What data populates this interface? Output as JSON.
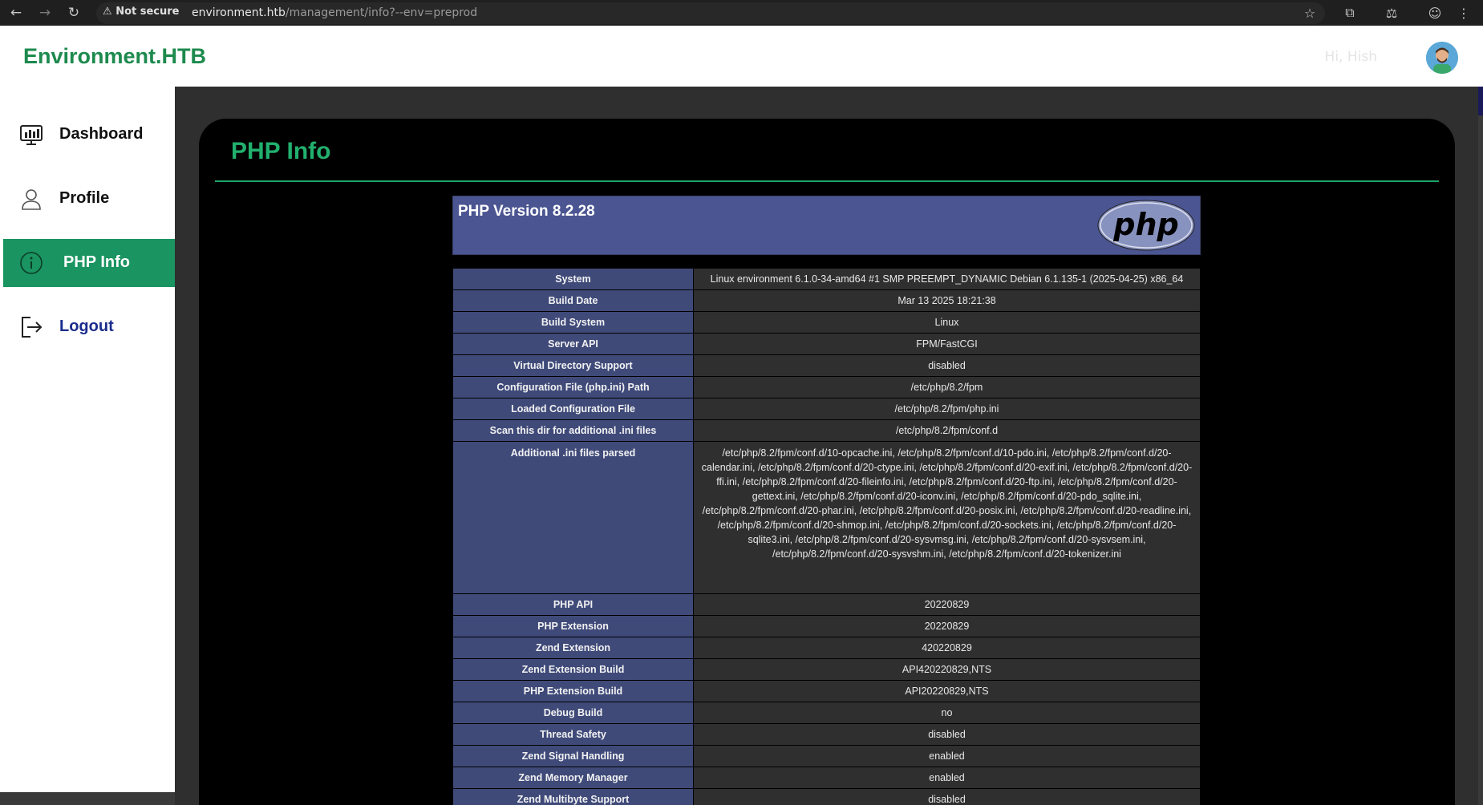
{
  "browser": {
    "warning": "Not secure",
    "url_host": "environment.htb",
    "url_path": "/management/info?--env=preprod"
  },
  "header": {
    "brand": "Environment.HTB",
    "greeting": "Hi, Hish"
  },
  "sidebar": {
    "items": [
      {
        "label": "Dashboard",
        "icon": "dashboard-icon"
      },
      {
        "label": "Profile",
        "icon": "user-icon"
      },
      {
        "label": "PHP Info",
        "icon": "info-icon",
        "active": true
      },
      {
        "label": "Logout",
        "icon": "logout-icon"
      }
    ]
  },
  "main": {
    "title": "PHP Info",
    "php_version": "PHP Version 8.2.28",
    "logo_text": "php",
    "rows": [
      {
        "key": "System",
        "value": "Linux environment 6.1.0-34-amd64 #1 SMP PREEMPT_DYNAMIC Debian 6.1.135-1 (2025-04-25) x86_64"
      },
      {
        "key": "Build Date",
        "value": "Mar 13 2025 18:21:38"
      },
      {
        "key": "Build System",
        "value": "Linux"
      },
      {
        "key": "Server API",
        "value": "FPM/FastCGI"
      },
      {
        "key": "Virtual Directory Support",
        "value": "disabled"
      },
      {
        "key": "Configuration File (php.ini) Path",
        "value": "/etc/php/8.2/fpm"
      },
      {
        "key": "Loaded Configuration File",
        "value": "/etc/php/8.2/fpm/php.ini"
      },
      {
        "key": "Scan this dir for additional .ini files",
        "value": "/etc/php/8.2/fpm/conf.d"
      },
      {
        "key": "Additional .ini files parsed",
        "value": "/etc/php/8.2/fpm/conf.d/10-opcache.ini, /etc/php/8.2/fpm/conf.d/10-pdo.ini, /etc/php/8.2/fpm/conf.d/20-calendar.ini, /etc/php/8.2/fpm/conf.d/20-ctype.ini, /etc/php/8.2/fpm/conf.d/20-exif.ini, /etc/php/8.2/fpm/conf.d/20-ffi.ini, /etc/php/8.2/fpm/conf.d/20-fileinfo.ini, /etc/php/8.2/fpm/conf.d/20-ftp.ini, /etc/php/8.2/fpm/conf.d/20-gettext.ini, /etc/php/8.2/fpm/conf.d/20-iconv.ini, /etc/php/8.2/fpm/conf.d/20-pdo_sqlite.ini, /etc/php/8.2/fpm/conf.d/20-phar.ini, /etc/php/8.2/fpm/conf.d/20-posix.ini, /etc/php/8.2/fpm/conf.d/20-readline.ini, /etc/php/8.2/fpm/conf.d/20-shmop.ini, /etc/php/8.2/fpm/conf.d/20-sockets.ini, /etc/php/8.2/fpm/conf.d/20-sqlite3.ini, /etc/php/8.2/fpm/conf.d/20-sysvmsg.ini, /etc/php/8.2/fpm/conf.d/20-sysvsem.ini, /etc/php/8.2/fpm/conf.d/20-sysvshm.ini, /etc/php/8.2/fpm/conf.d/20-tokenizer.ini",
        "tall": true
      },
      {
        "key": "PHP API",
        "value": "20220829"
      },
      {
        "key": "PHP Extension",
        "value": "20220829"
      },
      {
        "key": "Zend Extension",
        "value": "420220829"
      },
      {
        "key": "Zend Extension Build",
        "value": "API420220829,NTS"
      },
      {
        "key": "PHP Extension Build",
        "value": "API20220829,NTS"
      },
      {
        "key": "Debug Build",
        "value": "no"
      },
      {
        "key": "Thread Safety",
        "value": "disabled"
      },
      {
        "key": "Zend Signal Handling",
        "value": "enabled"
      },
      {
        "key": "Zend Memory Manager",
        "value": "enabled"
      },
      {
        "key": "Zend Multibyte Support",
        "value": "disabled"
      }
    ]
  },
  "colors": {
    "brand_green": "#1d8a4e",
    "active_green": "#1a9460",
    "php_header": "#4b5592",
    "key_cell": "#3f4a79",
    "value_cell": "#2f2f2f"
  }
}
